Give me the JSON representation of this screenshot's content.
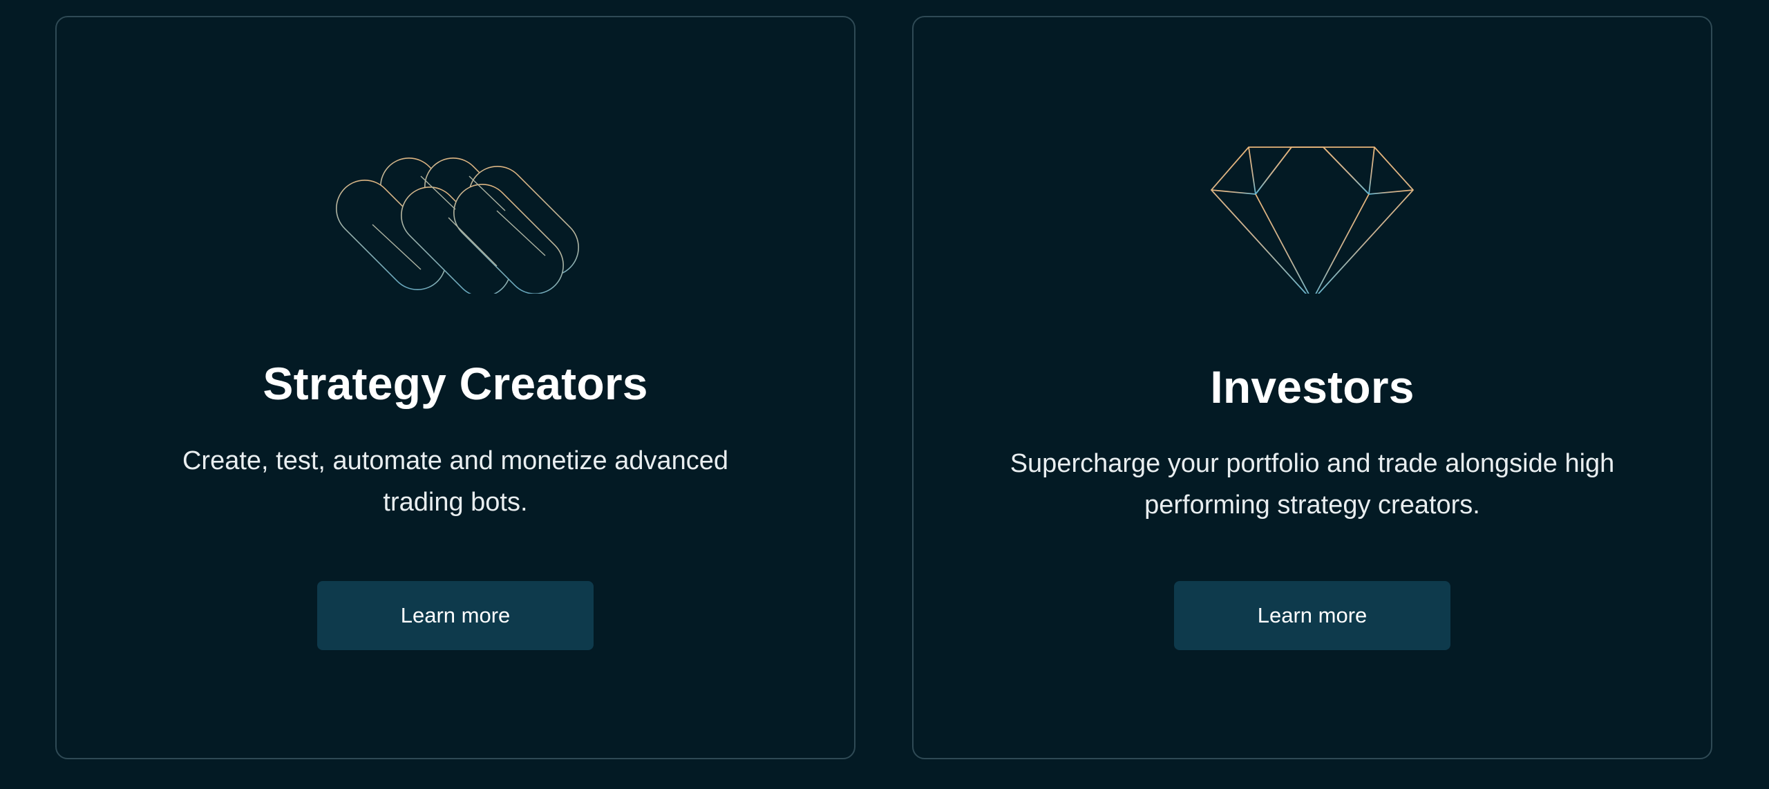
{
  "cards": [
    {
      "title": "Strategy Creators",
      "description": "Create, test, automate and monetize advanced trading bots.",
      "button_label": "Learn more",
      "icon": "linked-loops-icon"
    },
    {
      "title": "Investors",
      "description": "Supercharge your portfolio and trade alongside high performing strategy creators.",
      "button_label": "Learn more",
      "icon": "diamond-icon"
    }
  ],
  "colors": {
    "background": "#031a24",
    "card_border": "#2f4a55",
    "button": "#0e3a4c",
    "icon_gold": "#e3b27a",
    "icon_blue": "#6fb6cf"
  }
}
